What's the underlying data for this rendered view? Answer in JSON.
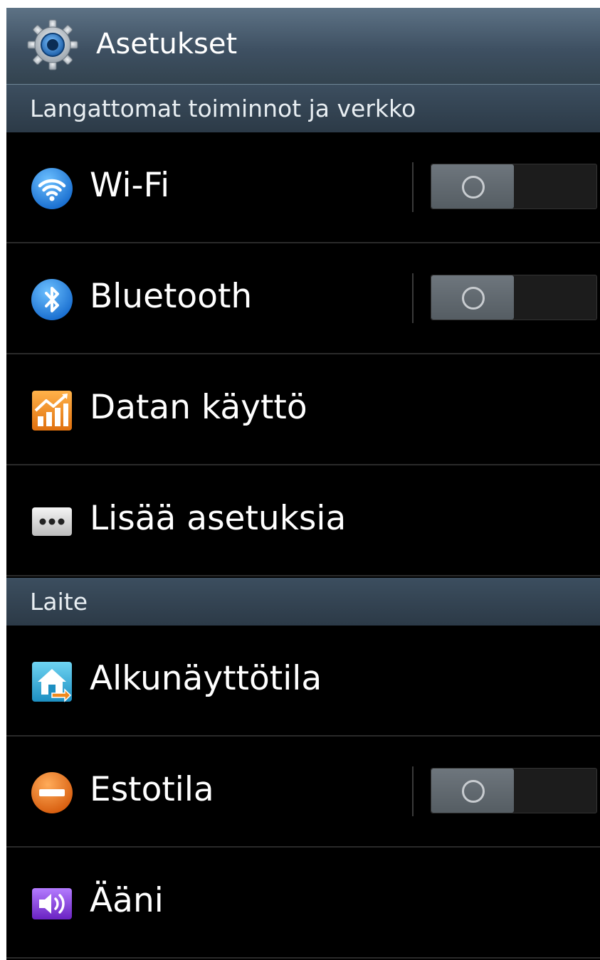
{
  "app_bar": {
    "title": "Asetukset",
    "icon": "settings-gear-icon"
  },
  "sections": [
    {
      "header": "Langattomat toiminnot ja verkko",
      "items": [
        {
          "label": "Wi-Fi",
          "icon": "wifi-icon",
          "toggle": "off"
        },
        {
          "label": "Bluetooth",
          "icon": "bluetooth-icon",
          "toggle": "off"
        },
        {
          "label": "Datan käyttö",
          "icon": "data-usage-chart-icon"
        },
        {
          "label": "Lisää asetuksia",
          "icon": "more-dots-icon"
        }
      ]
    },
    {
      "header": "Laite",
      "items": [
        {
          "label": "Alkunäyttötila",
          "icon": "home-screen-icon"
        },
        {
          "label": "Estotila",
          "icon": "blocking-mode-icon",
          "toggle": "off"
        },
        {
          "label": "Ääni",
          "icon": "sound-speaker-icon"
        }
      ]
    }
  ],
  "colors": {
    "background": "#000000",
    "action_bar": "#3e5062",
    "section_header": "#2f3e4c",
    "wifi_icon": "#2f8ce0",
    "bluetooth_icon": "#2f8ce0",
    "data_icon": "#f08a1e",
    "blocking_icon": "#e8741c",
    "sound_icon": "#8a3ad8"
  }
}
